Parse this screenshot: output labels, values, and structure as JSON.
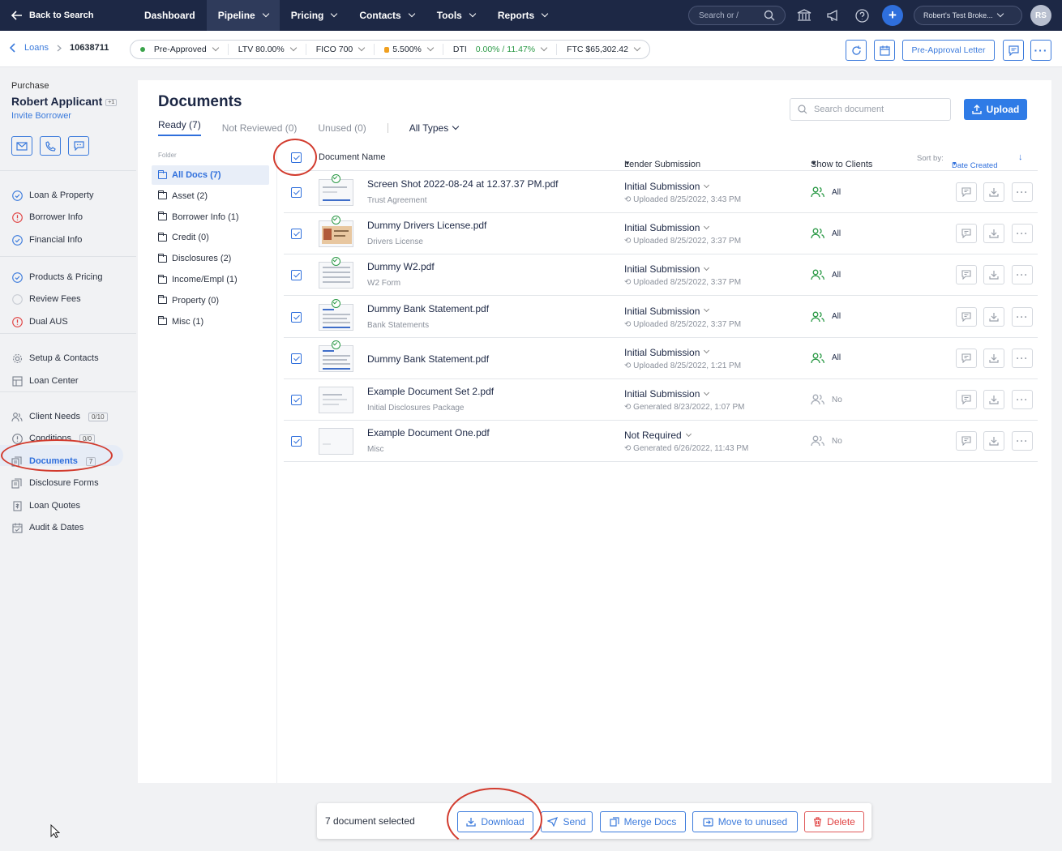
{
  "topnav": {
    "back": "Back to Search",
    "items": [
      {
        "label": "Dashboard",
        "dropdown": false
      },
      {
        "label": "Pipeline",
        "dropdown": true
      },
      {
        "label": "Pricing",
        "dropdown": true
      },
      {
        "label": "Contacts",
        "dropdown": true
      },
      {
        "label": "Tools",
        "dropdown": true
      },
      {
        "label": "Reports",
        "dropdown": true
      }
    ],
    "search_placeholder": "Search or /",
    "broker": "Robert's Test Broke...",
    "avatar": "RS"
  },
  "subbar": {
    "crumb_link": "Loans",
    "loan_number": "10638711",
    "status": "Pre-Approved",
    "ltv": "LTV 80.00%",
    "fico": "FICO 700",
    "rate": "5.500%",
    "dti_label": "DTI",
    "dti_values": "0.00% / 11.47%",
    "ftc": "FTC $65,302.42",
    "preapproval": "Pre-Approval Letter"
  },
  "sidebar": {
    "purpose": "Purchase",
    "name": "Robert Applicant",
    "name_tag": "+1",
    "invite": "Invite Borrower",
    "items": [
      {
        "label": "Loan & Property",
        "icon": "check"
      },
      {
        "label": "Borrower Info",
        "icon": "alert"
      },
      {
        "label": "Financial Info",
        "icon": "check"
      },
      {
        "label": "Products & Pricing",
        "icon": "check"
      },
      {
        "label": "Review Fees",
        "icon": "empty"
      },
      {
        "label": "Dual AUS",
        "icon": "alert"
      },
      {
        "label": "Setup & Contacts",
        "icon": "gear"
      },
      {
        "label": "Loan Center",
        "icon": "grid"
      },
      {
        "label": "Client Needs",
        "icon": "people",
        "badge": "0/10"
      },
      {
        "label": "Conditions",
        "icon": "info",
        "badge": "0/0"
      },
      {
        "label": "Documents",
        "icon": "docs",
        "badge": "7"
      },
      {
        "label": "Disclosure Forms",
        "icon": "docs"
      },
      {
        "label": "Loan Quotes",
        "icon": "quote"
      },
      {
        "label": "Audit & Dates",
        "icon": "calendar"
      }
    ]
  },
  "docs": {
    "title": "Documents",
    "tabs": [
      "Ready (7)",
      "Not Reviewed (0)",
      "Unused (0)"
    ],
    "types": "All Types",
    "search_placeholder": "Search document",
    "upload": "Upload",
    "folder_head": "Folder",
    "folders": [
      "All Docs (7)",
      "Asset (2)",
      "Borrower Info (1)",
      "Credit (0)",
      "Disclosures (2)",
      "Income/Empl (1)",
      "Property (0)",
      "Misc (1)"
    ],
    "columns": {
      "name": "Document Name",
      "submission": "Lender Submission",
      "show": "Show to Clients",
      "sortby": "Sort by:",
      "sortval": "Date Created"
    },
    "rows": [
      {
        "name": "Screen Shot 2022-08-24 at 12.37.37 PM.pdf",
        "type": "Trust Agreement",
        "submission": "Initial Submission",
        "date": "Uploaded 8/25/2022, 3:43 PM",
        "show": "All",
        "reviewed": true
      },
      {
        "name": "Dummy Drivers License.pdf",
        "type": "Drivers License",
        "submission": "Initial Submission",
        "date": "Uploaded 8/25/2022, 3:37 PM",
        "show": "All",
        "reviewed": true
      },
      {
        "name": "Dummy W2.pdf",
        "type": "W2 Form",
        "submission": "Initial Submission",
        "date": "Uploaded 8/25/2022, 3:37 PM",
        "show": "All",
        "reviewed": true
      },
      {
        "name": "Dummy Bank Statement.pdf",
        "type": "Bank Statements",
        "submission": "Initial Submission",
        "date": "Uploaded 8/25/2022, 3:37 PM",
        "show": "All",
        "reviewed": true
      },
      {
        "name": "Dummy Bank Statement.pdf",
        "type": "",
        "submission": "Initial Submission",
        "date": "Uploaded 8/25/2022, 1:21 PM",
        "show": "All",
        "reviewed": true
      },
      {
        "name": "Example Document Set 2.pdf",
        "type": "Initial Disclosures Package",
        "submission": "Initial Submission",
        "date": "Generated 8/23/2022, 1:07 PM",
        "show": "No",
        "reviewed": false
      },
      {
        "name": "Example Document One.pdf",
        "type": "Misc",
        "submission": "Not Required",
        "date": "Generated 6/26/2022, 11:43 PM",
        "show": "No",
        "reviewed": false
      }
    ]
  },
  "bottombar": {
    "selected": "7 document selected",
    "download": "Download",
    "send": "Send",
    "merge": "Merge Docs",
    "unused": "Move to unused",
    "delete": "Delete"
  }
}
